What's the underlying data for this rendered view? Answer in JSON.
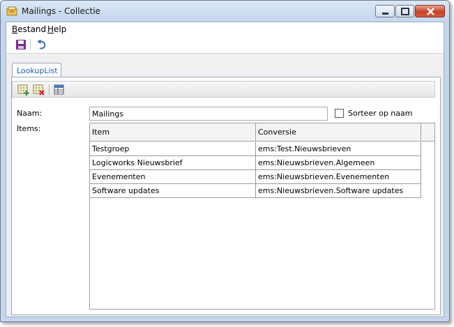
{
  "window": {
    "title": "Mailings - Collectie"
  },
  "menu": {
    "items": [
      {
        "accel": "B",
        "rest": "estand"
      },
      {
        "accel": "H",
        "rest": "elp"
      }
    ]
  },
  "toolbar": {
    "icons": [
      "save-icon",
      "undo-icon"
    ]
  },
  "tab": {
    "label": "LookupList"
  },
  "sub_toolbar": {
    "icons": [
      "add-row-icon",
      "delete-row-icon",
      "grid-settings-icon"
    ]
  },
  "form": {
    "name_label": "Naam:",
    "name_value": "Mailings",
    "sort_label": "Sorteer op naam",
    "sort_checked": false,
    "items_label": "Items:"
  },
  "grid": {
    "columns": [
      "Item",
      "Conversie"
    ],
    "rows": [
      [
        "Testgroep",
        "ems:Test.Nieuwsbrieven"
      ],
      [
        "Logicworks Nieuwsbrief",
        "ems:Nieuwsbrieven.Algemeen"
      ],
      [
        "Evenementen",
        "ems:Nieuwsbrieven.Evenementen"
      ],
      [
        "Software updates",
        "ems:Nieuwsbrieven.Software updates"
      ]
    ]
  },
  "colors": {
    "accent": "#1d5fa8",
    "close_button": "#c7422a"
  }
}
